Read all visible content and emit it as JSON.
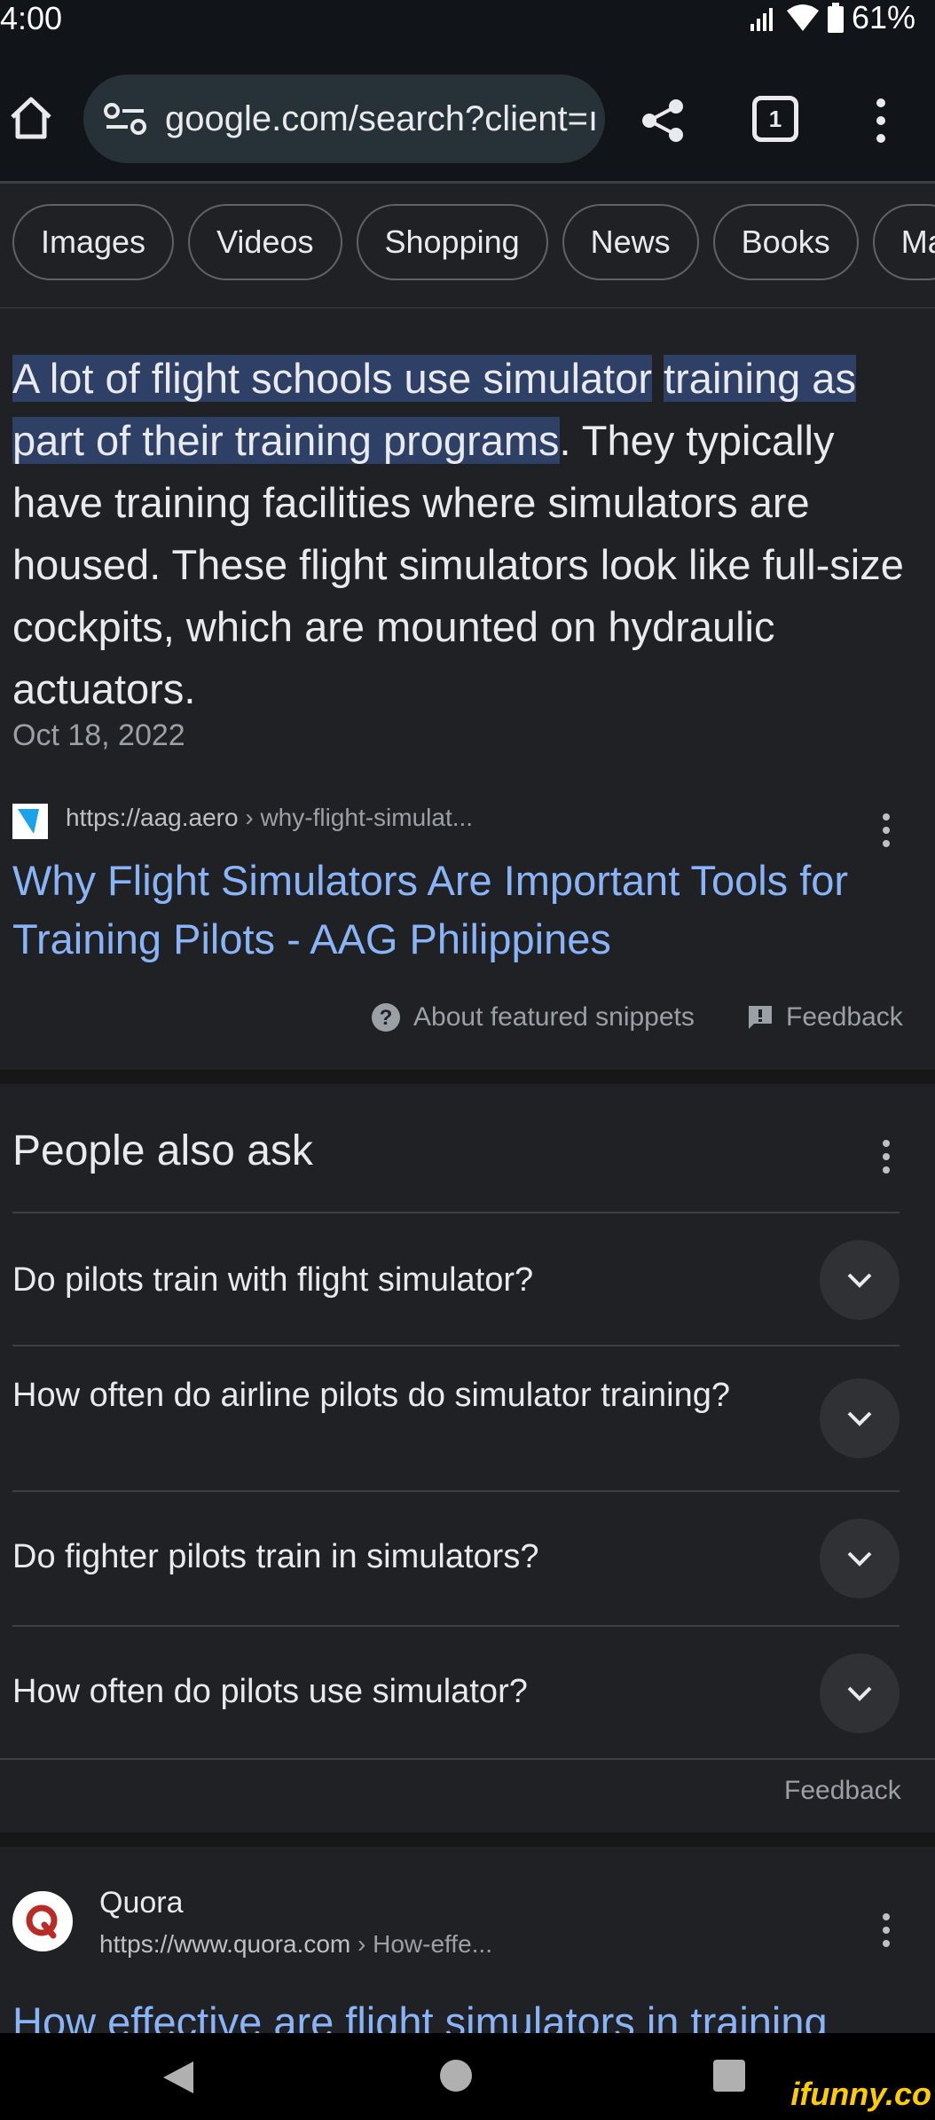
{
  "status_bar": {
    "time": "4:00",
    "battery": "61%"
  },
  "browser": {
    "url": "google.com/search?client=ı",
    "tab_count": "1"
  },
  "chips": [
    "Images",
    "Videos",
    "Shopping",
    "News",
    "Books",
    "Map"
  ],
  "snippet": {
    "highlight_line1": "A lot of flight schools use simulator",
    "highlight_line2": "training as part of their training programs",
    "rest": ". They typically have training facilities where simulators are housed. These flight simulators look like full-size cockpits, which are mounted on hydraulic actuators.",
    "date": "Oct 18, 2022",
    "source_url_domain": "https://aag.aero",
    "source_url_path": " › why-flight-simulat...",
    "title": "Why Flight Simulators Are Important Tools for Training Pilots - AAG Philippines",
    "about_label": "About featured snippets",
    "feedback_label": "Feedback"
  },
  "people_also_ask": {
    "title": "People also ask",
    "questions": [
      "Do pilots train with flight simulator?",
      "How often do airline pilots do simulator training?",
      "Do fighter pilots train in simulators?",
      "How often do pilots use simulator?"
    ],
    "feedback_label": "Feedback"
  },
  "quora_result": {
    "site_name": "Quora",
    "url_domain": "https://www.quora.com",
    "url_path": " › How-effe...",
    "title": "How effective are flight simulators in training"
  },
  "watermark": "ifunny.co",
  "icons": {
    "home": "home-icon",
    "site_settings": "tune-icon",
    "share": "share-icon",
    "menu": "more-vert-icon",
    "help": "help-circle-icon",
    "feedback": "feedback-icon",
    "expand": "chevron-down-icon",
    "back": "back-triangle-icon"
  }
}
